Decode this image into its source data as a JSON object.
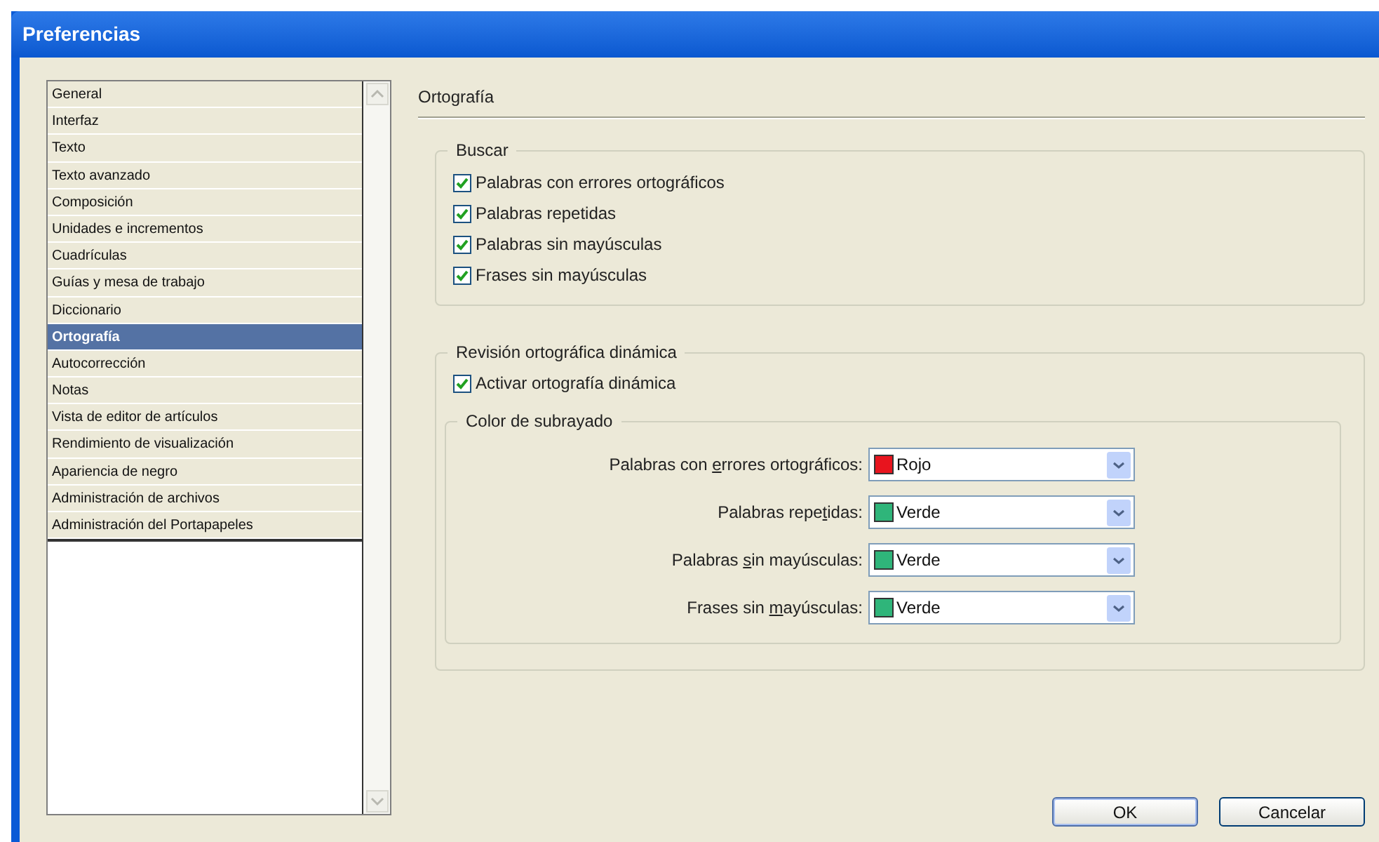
{
  "window": {
    "title": "Preferencias"
  },
  "sidebar": {
    "items": [
      {
        "label": "General",
        "selected": false
      },
      {
        "label": "Interfaz",
        "selected": false
      },
      {
        "label": "Texto",
        "selected": false
      },
      {
        "label": "Texto avanzado",
        "selected": false
      },
      {
        "label": "Composición",
        "selected": false
      },
      {
        "label": "Unidades e incrementos",
        "selected": false
      },
      {
        "label": "Cuadrículas",
        "selected": false
      },
      {
        "label": "Guías y mesa de trabajo",
        "selected": false
      },
      {
        "label": "Diccionario",
        "selected": false
      },
      {
        "label": "Ortografía",
        "selected": true
      },
      {
        "label": "Autocorrección",
        "selected": false
      },
      {
        "label": "Notas",
        "selected": false
      },
      {
        "label": "Vista de editor de artículos",
        "selected": false
      },
      {
        "label": "Rendimiento de visualización",
        "selected": false
      },
      {
        "label": "Apariencia de negro",
        "selected": false
      },
      {
        "label": "Administración de archivos",
        "selected": false
      },
      {
        "label": "Administración del Portapapeles",
        "selected": false
      }
    ]
  },
  "section_title": "Ortografía",
  "buscar": {
    "title": "Buscar",
    "options": [
      {
        "label": "Palabras con errores ortográficos",
        "checked": true
      },
      {
        "label": "Palabras repetidas",
        "checked": true
      },
      {
        "label": "Palabras sin mayúsculas",
        "checked": true
      },
      {
        "label": "Frases sin mayúsculas",
        "checked": true
      }
    ]
  },
  "dynamic": {
    "title": "Revisión ortográfica dinámica",
    "enable": {
      "label": "Activar ortografía dinámica",
      "checked": true
    },
    "underline": {
      "title": "Color de subrayado",
      "rows": [
        {
          "before": "Palabras con ",
          "mnemonic": "e",
          "after": "rrores ortográficos:",
          "value": "Rojo",
          "color": "#e8141e"
        },
        {
          "before": "Palabras repe",
          "mnemonic": "t",
          "after": "idas:",
          "value": "Verde",
          "color": "#2fb57a"
        },
        {
          "before": "Palabras ",
          "mnemonic": "s",
          "after": "in mayúsculas:",
          "value": "Verde",
          "color": "#2fb57a"
        },
        {
          "before": "Frases sin ",
          "mnemonic": "m",
          "after": "ayúsculas:",
          "value": "Verde",
          "color": "#2fb57a"
        }
      ]
    }
  },
  "buttons": [
    {
      "label": "OK",
      "default": true
    },
    {
      "label": "Cancelar",
      "default": false
    }
  ]
}
